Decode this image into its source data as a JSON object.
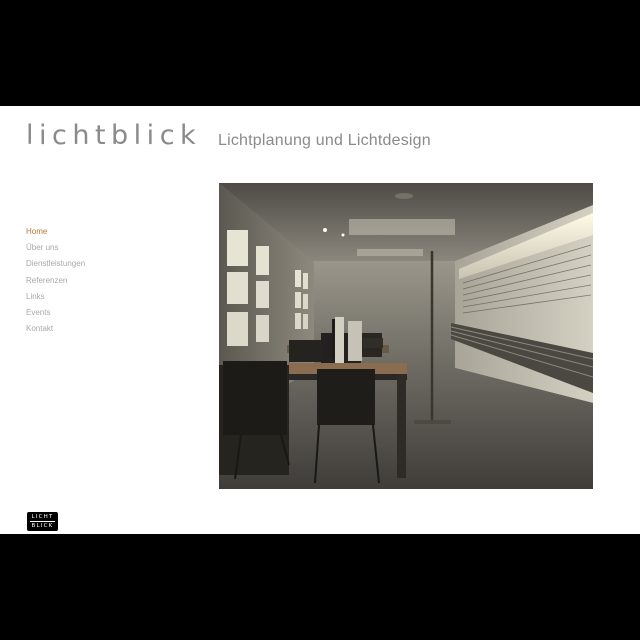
{
  "header": {
    "brand": "lichtblick",
    "tagline": "Lichtplanung und Lichtdesign"
  },
  "nav": {
    "items": [
      {
        "label": "Home",
        "active": true
      },
      {
        "label": "Über uns",
        "active": false
      },
      {
        "label": "Dienstleistungen",
        "active": false
      },
      {
        "label": "Referenzen",
        "active": false
      },
      {
        "label": "Links",
        "active": false
      },
      {
        "label": "Events",
        "active": false
      },
      {
        "label": "Kontakt",
        "active": false
      }
    ]
  },
  "footer": {
    "logo_line1": "LICHT",
    "logo_line2": "BLICK"
  },
  "colors": {
    "background": "#000000",
    "page": "#ffffff",
    "text_gray": "#8a8a8a",
    "nav_active": "#b37a3c"
  }
}
